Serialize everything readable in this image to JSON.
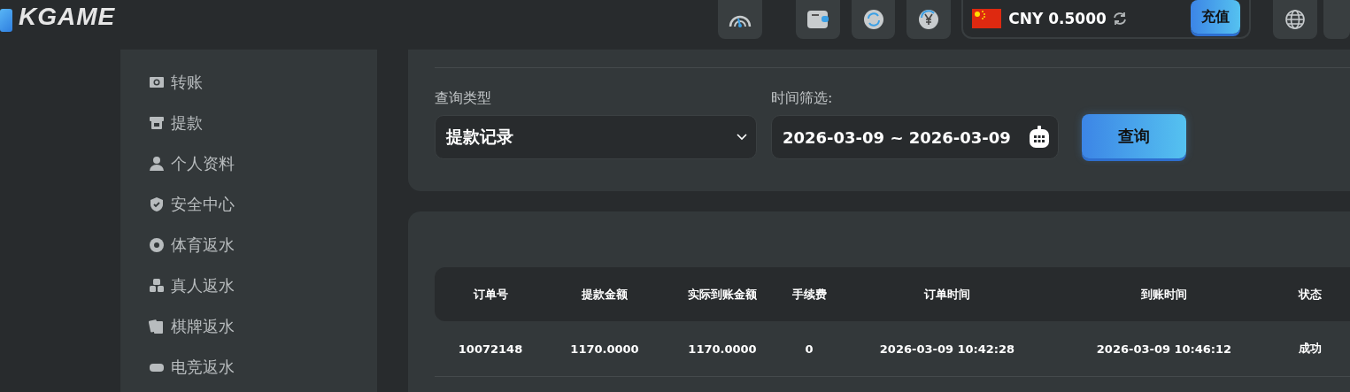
{
  "header": {
    "logo": "KGAME",
    "currency": "CNY 0.5000",
    "deposit_button": "充值"
  },
  "sidebar": {
    "items": [
      {
        "label": "转账"
      },
      {
        "label": "提款"
      },
      {
        "label": "个人资料"
      },
      {
        "label": "安全中心"
      },
      {
        "label": "体育返水"
      },
      {
        "label": "真人返水"
      },
      {
        "label": "棋牌返水"
      },
      {
        "label": "电竞返水"
      }
    ]
  },
  "filter": {
    "type_label": "查询类型",
    "type_value": "提款记录",
    "time_label": "时间筛选:",
    "date_range": "2026-03-09 ~ 2026-03-09",
    "query_button": "查询"
  },
  "table": {
    "columns": [
      "订单号",
      "提款金额",
      "实际到账金额",
      "手续费",
      "订单时间",
      "到账时间",
      "状态"
    ],
    "rows": [
      [
        "10072148",
        "1170.0000",
        "1170.0000",
        "0",
        "2026-03-09 10:42:28",
        "2026-03-09 10:46:12",
        "成功"
      ]
    ]
  }
}
